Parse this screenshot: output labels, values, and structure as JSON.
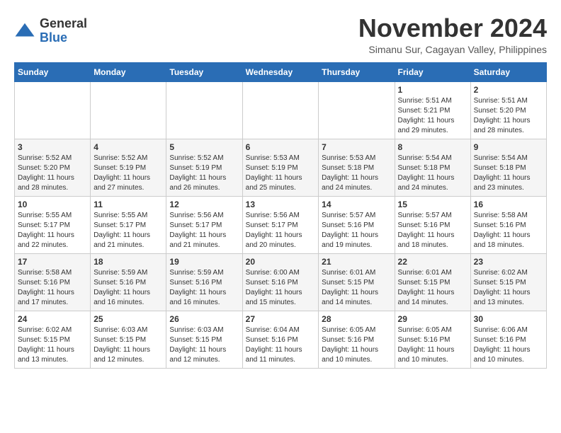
{
  "logo": {
    "general": "General",
    "blue": "Blue"
  },
  "title": "November 2024",
  "subtitle": "Simanu Sur, Cagayan Valley, Philippines",
  "days_header": [
    "Sunday",
    "Monday",
    "Tuesday",
    "Wednesday",
    "Thursday",
    "Friday",
    "Saturday"
  ],
  "weeks": [
    [
      {
        "num": "",
        "sunrise": "",
        "sunset": "",
        "daylight": ""
      },
      {
        "num": "",
        "sunrise": "",
        "sunset": "",
        "daylight": ""
      },
      {
        "num": "",
        "sunrise": "",
        "sunset": "",
        "daylight": ""
      },
      {
        "num": "",
        "sunrise": "",
        "sunset": "",
        "daylight": ""
      },
      {
        "num": "",
        "sunrise": "",
        "sunset": "",
        "daylight": ""
      },
      {
        "num": "1",
        "sunrise": "Sunrise: 5:51 AM",
        "sunset": "Sunset: 5:21 PM",
        "daylight": "Daylight: 11 hours and 29 minutes."
      },
      {
        "num": "2",
        "sunrise": "Sunrise: 5:51 AM",
        "sunset": "Sunset: 5:20 PM",
        "daylight": "Daylight: 11 hours and 28 minutes."
      }
    ],
    [
      {
        "num": "3",
        "sunrise": "Sunrise: 5:52 AM",
        "sunset": "Sunset: 5:20 PM",
        "daylight": "Daylight: 11 hours and 28 minutes."
      },
      {
        "num": "4",
        "sunrise": "Sunrise: 5:52 AM",
        "sunset": "Sunset: 5:19 PM",
        "daylight": "Daylight: 11 hours and 27 minutes."
      },
      {
        "num": "5",
        "sunrise": "Sunrise: 5:52 AM",
        "sunset": "Sunset: 5:19 PM",
        "daylight": "Daylight: 11 hours and 26 minutes."
      },
      {
        "num": "6",
        "sunrise": "Sunrise: 5:53 AM",
        "sunset": "Sunset: 5:19 PM",
        "daylight": "Daylight: 11 hours and 25 minutes."
      },
      {
        "num": "7",
        "sunrise": "Sunrise: 5:53 AM",
        "sunset": "Sunset: 5:18 PM",
        "daylight": "Daylight: 11 hours and 24 minutes."
      },
      {
        "num": "8",
        "sunrise": "Sunrise: 5:54 AM",
        "sunset": "Sunset: 5:18 PM",
        "daylight": "Daylight: 11 hours and 24 minutes."
      },
      {
        "num": "9",
        "sunrise": "Sunrise: 5:54 AM",
        "sunset": "Sunset: 5:18 PM",
        "daylight": "Daylight: 11 hours and 23 minutes."
      }
    ],
    [
      {
        "num": "10",
        "sunrise": "Sunrise: 5:55 AM",
        "sunset": "Sunset: 5:17 PM",
        "daylight": "Daylight: 11 hours and 22 minutes."
      },
      {
        "num": "11",
        "sunrise": "Sunrise: 5:55 AM",
        "sunset": "Sunset: 5:17 PM",
        "daylight": "Daylight: 11 hours and 21 minutes."
      },
      {
        "num": "12",
        "sunrise": "Sunrise: 5:56 AM",
        "sunset": "Sunset: 5:17 PM",
        "daylight": "Daylight: 11 hours and 21 minutes."
      },
      {
        "num": "13",
        "sunrise": "Sunrise: 5:56 AM",
        "sunset": "Sunset: 5:17 PM",
        "daylight": "Daylight: 11 hours and 20 minutes."
      },
      {
        "num": "14",
        "sunrise": "Sunrise: 5:57 AM",
        "sunset": "Sunset: 5:16 PM",
        "daylight": "Daylight: 11 hours and 19 minutes."
      },
      {
        "num": "15",
        "sunrise": "Sunrise: 5:57 AM",
        "sunset": "Sunset: 5:16 PM",
        "daylight": "Daylight: 11 hours and 18 minutes."
      },
      {
        "num": "16",
        "sunrise": "Sunrise: 5:58 AM",
        "sunset": "Sunset: 5:16 PM",
        "daylight": "Daylight: 11 hours and 18 minutes."
      }
    ],
    [
      {
        "num": "17",
        "sunrise": "Sunrise: 5:58 AM",
        "sunset": "Sunset: 5:16 PM",
        "daylight": "Daylight: 11 hours and 17 minutes."
      },
      {
        "num": "18",
        "sunrise": "Sunrise: 5:59 AM",
        "sunset": "Sunset: 5:16 PM",
        "daylight": "Daylight: 11 hours and 16 minutes."
      },
      {
        "num": "19",
        "sunrise": "Sunrise: 5:59 AM",
        "sunset": "Sunset: 5:16 PM",
        "daylight": "Daylight: 11 hours and 16 minutes."
      },
      {
        "num": "20",
        "sunrise": "Sunrise: 6:00 AM",
        "sunset": "Sunset: 5:16 PM",
        "daylight": "Daylight: 11 hours and 15 minutes."
      },
      {
        "num": "21",
        "sunrise": "Sunrise: 6:01 AM",
        "sunset": "Sunset: 5:15 PM",
        "daylight": "Daylight: 11 hours and 14 minutes."
      },
      {
        "num": "22",
        "sunrise": "Sunrise: 6:01 AM",
        "sunset": "Sunset: 5:15 PM",
        "daylight": "Daylight: 11 hours and 14 minutes."
      },
      {
        "num": "23",
        "sunrise": "Sunrise: 6:02 AM",
        "sunset": "Sunset: 5:15 PM",
        "daylight": "Daylight: 11 hours and 13 minutes."
      }
    ],
    [
      {
        "num": "24",
        "sunrise": "Sunrise: 6:02 AM",
        "sunset": "Sunset: 5:15 PM",
        "daylight": "Daylight: 11 hours and 13 minutes."
      },
      {
        "num": "25",
        "sunrise": "Sunrise: 6:03 AM",
        "sunset": "Sunset: 5:15 PM",
        "daylight": "Daylight: 11 hours and 12 minutes."
      },
      {
        "num": "26",
        "sunrise": "Sunrise: 6:03 AM",
        "sunset": "Sunset: 5:15 PM",
        "daylight": "Daylight: 11 hours and 12 minutes."
      },
      {
        "num": "27",
        "sunrise": "Sunrise: 6:04 AM",
        "sunset": "Sunset: 5:16 PM",
        "daylight": "Daylight: 11 hours and 11 minutes."
      },
      {
        "num": "28",
        "sunrise": "Sunrise: 6:05 AM",
        "sunset": "Sunset: 5:16 PM",
        "daylight": "Daylight: 11 hours and 10 minutes."
      },
      {
        "num": "29",
        "sunrise": "Sunrise: 6:05 AM",
        "sunset": "Sunset: 5:16 PM",
        "daylight": "Daylight: 11 hours and 10 minutes."
      },
      {
        "num": "30",
        "sunrise": "Sunrise: 6:06 AM",
        "sunset": "Sunset: 5:16 PM",
        "daylight": "Daylight: 11 hours and 10 minutes."
      }
    ]
  ]
}
